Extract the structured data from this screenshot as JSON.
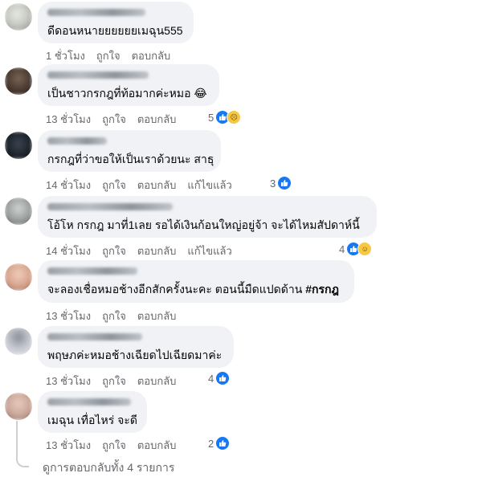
{
  "comments": [
    {
      "text": "ดีดอนหนายยยยยยเมฉุน555",
      "time": "1 ชั่วโมง",
      "like": "ถูกใจ",
      "reply": "ตอบกลับ",
      "avatar_color": "#c9ccc5"
    },
    {
      "text": "เป็นชาวกรกฎที่ท้อมากค่ะหมอ 😂",
      "time": "13 ชั่วโมง",
      "like": "ถูกใจ",
      "reply": "ตอบกลับ",
      "reaction_count": "5",
      "reactions": [
        "like-icon",
        "sad-icon"
      ],
      "avatar_color": "#4a3a30"
    },
    {
      "text": "กรกฎที่ว่าขอให้เป็นเราด้วยนะ สาธุ",
      "time": "14 ชั่วโมง",
      "like": "ถูกใจ",
      "reply": "ตอบกลับ",
      "edited": "แก้ไขแล้ว",
      "reaction_count": "3",
      "reactions": [
        "like-icon"
      ],
      "avatar_color": "#1c2128"
    },
    {
      "text": "โอ้โห กรกฎ มาที่1เลย รอได้เงินก้อนใหญ่อยู่จ้า จะได้ไหมสัปดาห์นี้",
      "time": "14 ชั่วโมง",
      "like": "ถูกใจ",
      "reply": "ตอบกลับ",
      "edited": "แก้ไขแล้ว",
      "reaction_count": "4",
      "reactions": [
        "like-icon",
        "laugh-icon"
      ],
      "avatar_color": "#9b9f9e"
    },
    {
      "text": "จะลองเชื่อหมอช้างอีกสักครั้งนะคะ ตอนนี้มืดแปดด้าน",
      "hashtag": "#กรกฎ",
      "time": "13 ชั่วโมง",
      "like": "ถูกใจ",
      "reply": "ตอบกลับ",
      "avatar_color": "#d8a58e"
    },
    {
      "text": "พฤษภค่ะหมอช้างเฉียดไปเฉียดมาค่ะ",
      "time": "13 ชั่วโมง",
      "like": "ถูกใจ",
      "reply": "ตอบกลับ",
      "reaction_count": "4",
      "reactions": [
        "like-icon"
      ],
      "avatar_color": "#c8ccd2"
    },
    {
      "text": "เมฉุน เทื่อไหร่ จะดี",
      "time": "13 ชั่วโมง",
      "like": "ถูกใจ",
      "reply": "ตอบกลับ",
      "reaction_count": "2",
      "reactions": [
        "like-icon"
      ],
      "avatar_color": "#c9a89a"
    }
  ],
  "view_replies": "ดูการตอบกลับทั้ง 4 รายการ",
  "colors": {
    "bubble": "#f0f2f5",
    "meta_text": "#65676b",
    "like_blue": "#1877f2"
  }
}
